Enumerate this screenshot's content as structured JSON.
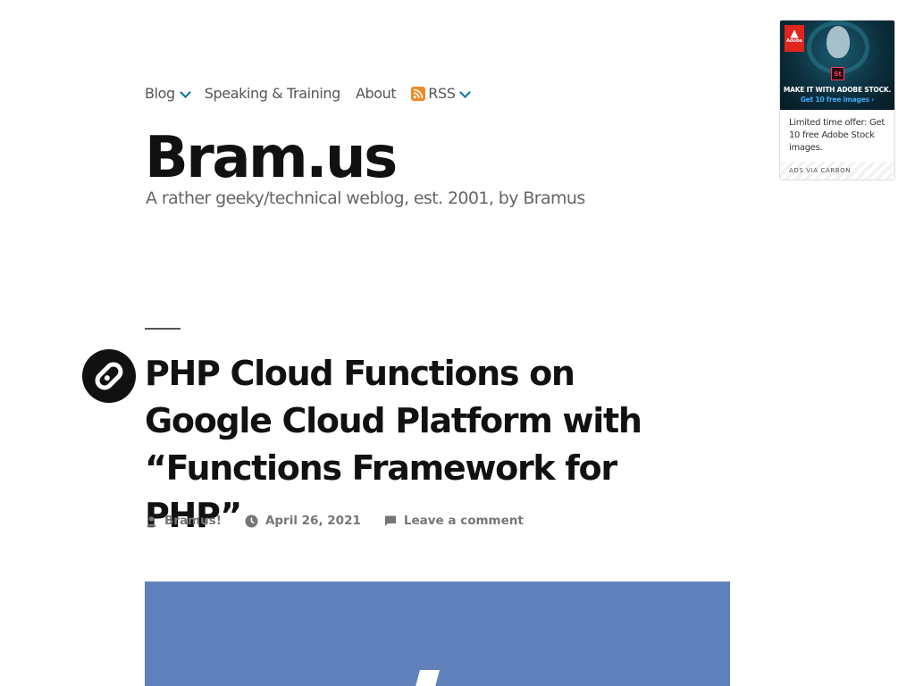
{
  "nav": {
    "items": [
      {
        "label": "Blog",
        "has_dropdown": true
      },
      {
        "label": "Speaking & Training",
        "has_dropdown": false
      },
      {
        "label": "About",
        "has_dropdown": false
      },
      {
        "label": "RSS",
        "has_dropdown": true,
        "icon": "rss-icon"
      }
    ]
  },
  "site": {
    "title": "Bram.us",
    "description": "A rather geeky/technical weblog, est. 2001, by Bramus"
  },
  "post": {
    "format_icon": "link-icon",
    "title": "PHP Cloud Functions on Google Cloud Platform with “Functions Framework for PHP”",
    "meta": {
      "author": "Bramus!",
      "date": "April 26, 2021",
      "comments": "Leave a comment"
    },
    "featured_image_color": "#6081bb"
  },
  "ad": {
    "logo_text": "Adobe",
    "product_badge": "St",
    "headline": "MAKE IT WITH ADOBE STOCK.",
    "cta": "Get 10 free images ›",
    "text": "Limited time offer: Get 10 free Adobe Stock images.",
    "via": "ADS VIA CARBON"
  },
  "colors": {
    "accent": "#0073aa",
    "rss": "#f08a24",
    "text": "#111111",
    "muted": "#767676"
  }
}
